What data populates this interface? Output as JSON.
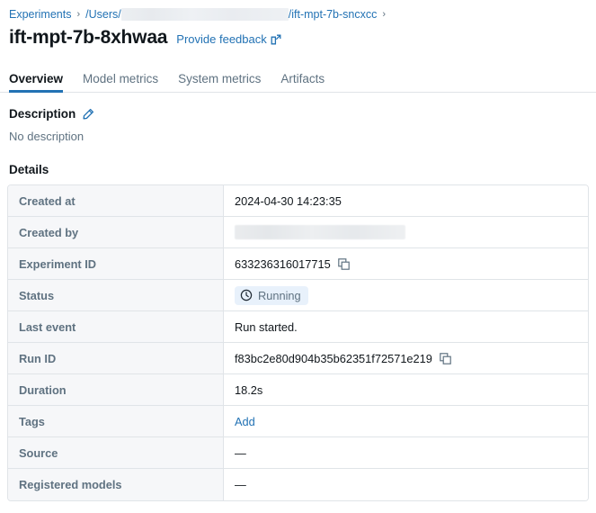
{
  "breadcrumb": {
    "root_label": "Experiments",
    "separator": "›",
    "path_prefix": "/Users/",
    "path_redacted": true,
    "path_suffix": "/ift-mpt-7b-sncxcc",
    "trailing_separator": "›"
  },
  "header": {
    "title": "ift-mpt-7b-8xhwaa",
    "feedback_label": "Provide feedback",
    "feedback_icon": "external-link-icon"
  },
  "tabs": [
    {
      "label": "Overview",
      "active": true
    },
    {
      "label": "Model metrics",
      "active": false
    },
    {
      "label": "System metrics",
      "active": false
    },
    {
      "label": "Artifacts",
      "active": false
    }
  ],
  "description": {
    "heading": "Description",
    "edit_icon": "pencil-icon",
    "body": "No description"
  },
  "details": {
    "heading": "Details",
    "rows": [
      {
        "label": "Created at",
        "value": "2024-04-30 14:23:35",
        "type": "text"
      },
      {
        "label": "Created by",
        "value": "",
        "type": "redacted"
      },
      {
        "label": "Experiment ID",
        "value": "633236316017715",
        "type": "copyable"
      },
      {
        "label": "Status",
        "value": "Running",
        "type": "badge",
        "badge_icon": "clock-icon"
      },
      {
        "label": "Last event",
        "value": "Run started.",
        "type": "text"
      },
      {
        "label": "Run ID",
        "value": "f83bc2e80d904b35b62351f72571e219",
        "type": "copyable"
      },
      {
        "label": "Duration",
        "value": "18.2s",
        "type": "text"
      },
      {
        "label": "Tags",
        "value": "Add",
        "type": "link"
      },
      {
        "label": "Source",
        "value": "—",
        "type": "text"
      },
      {
        "label": "Registered models",
        "value": "—",
        "type": "text"
      }
    ]
  },
  "colors": {
    "link": "#2272b4",
    "text": "#11171c",
    "muted": "#5f7281",
    "border": "#e0e4e8",
    "label_bg": "#f6f7f9",
    "badge_bg": "#e8f1fb"
  }
}
